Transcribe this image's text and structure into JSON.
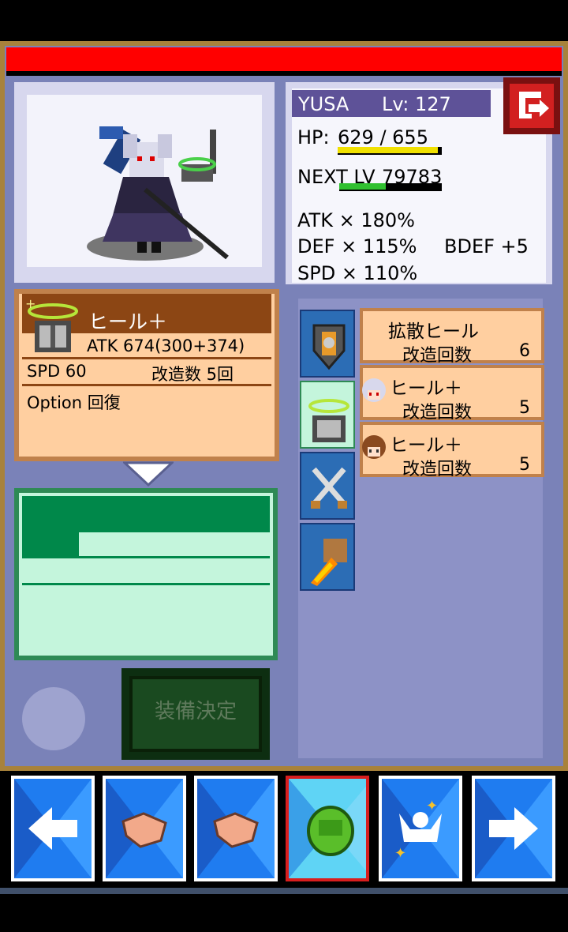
{
  "character": {
    "name": "YUSA",
    "level": "Lv: 127",
    "hp_label": "HP:",
    "hp_value": "629 / 655",
    "hp_fraction": 0.96,
    "next_label": "NEXT LV",
    "next_value": "79783",
    "next_fraction": 0.45,
    "atk": "ATK  × 180%",
    "def": "DEF  × 115%",
    "bdef": "BDEF  +5",
    "spd": "SPD  × 110%"
  },
  "equipment": {
    "name": "ヒール＋",
    "atk": "ATK   674(300+374)",
    "spd": "SPD   60",
    "mods": "改造数   5回",
    "option": "Option   回復",
    "icon": "heal-cart-icon"
  },
  "confirm_button": "装備決定",
  "tabs": [
    {
      "icon": "shield-icon"
    },
    {
      "icon": "heal-cart-icon"
    },
    {
      "icon": "crossed-swords-icon"
    },
    {
      "icon": "bazooka-icon"
    }
  ],
  "items": [
    {
      "name": "拡散ヒール",
      "sub_label": "改造回数",
      "count": "6",
      "owner_icon": ""
    },
    {
      "name": "ヒール＋",
      "sub_label": "改造回数",
      "count": "5",
      "owner_icon": "silver-haired-girl-icon"
    },
    {
      "name": "ヒール＋",
      "sub_label": "改造回数",
      "count": "5",
      "owner_icon": "brown-haired-girl-icon"
    }
  ],
  "nav": [
    {
      "icon": "left-arrow-icon"
    },
    {
      "icon": "handshake-icon"
    },
    {
      "icon": "handshake-icon"
    },
    {
      "icon": "backpack-icon",
      "active": true
    },
    {
      "icon": "party-icon"
    },
    {
      "icon": "right-arrow-icon"
    }
  ],
  "colors": {
    "hp_gauge": "#f0e000",
    "exp_gauge": "#30c030",
    "name_bar": "#5e5298",
    "accent_red": "#ff0000"
  }
}
